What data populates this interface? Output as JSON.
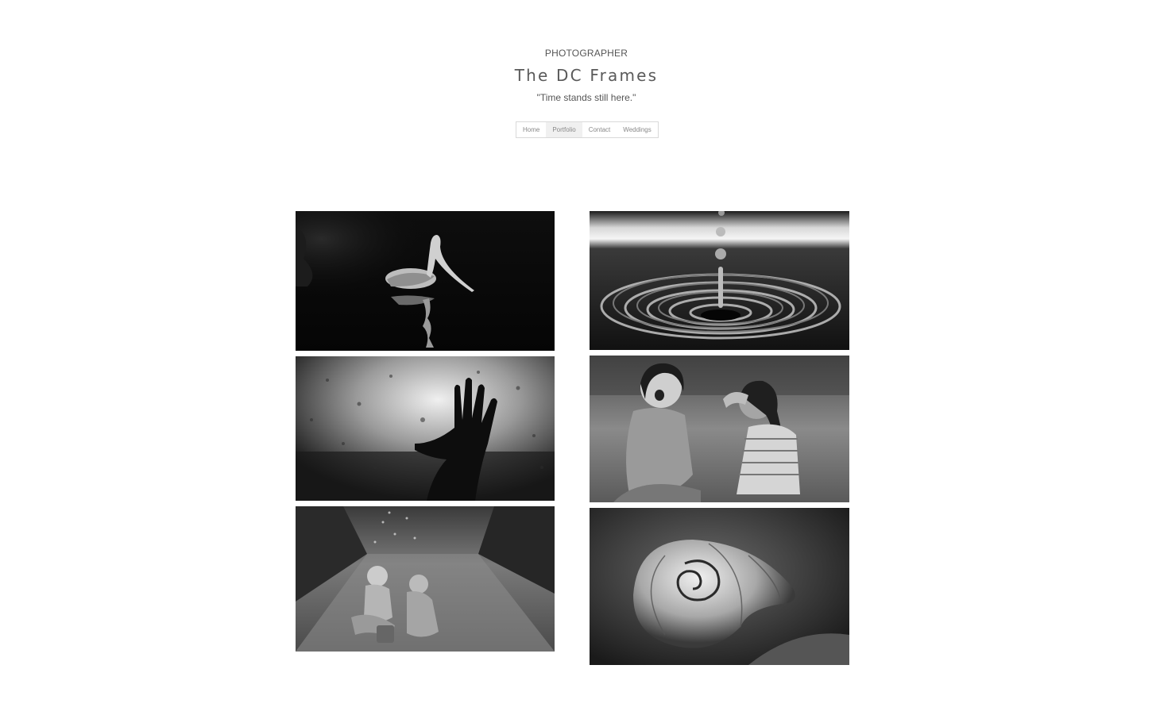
{
  "header": {
    "role": "PHOTOGRAPHER",
    "site_title": "The DC Frames",
    "tagline": "\"Time stands still here.\""
  },
  "nav": {
    "items": [
      {
        "label": "Home",
        "active": false
      },
      {
        "label": "Portfolio",
        "active": true
      },
      {
        "label": "Contact",
        "active": false
      },
      {
        "label": "Weddings",
        "active": false
      }
    ]
  },
  "gallery": {
    "photos": [
      {
        "subject": "pelican-on-water"
      },
      {
        "subject": "water-droplet-splash"
      },
      {
        "subject": "hand-on-rainy-window"
      },
      {
        "subject": "two-girls-laughing"
      },
      {
        "subject": "children-playing-in-rain"
      },
      {
        "subject": "snail-shell"
      }
    ]
  }
}
